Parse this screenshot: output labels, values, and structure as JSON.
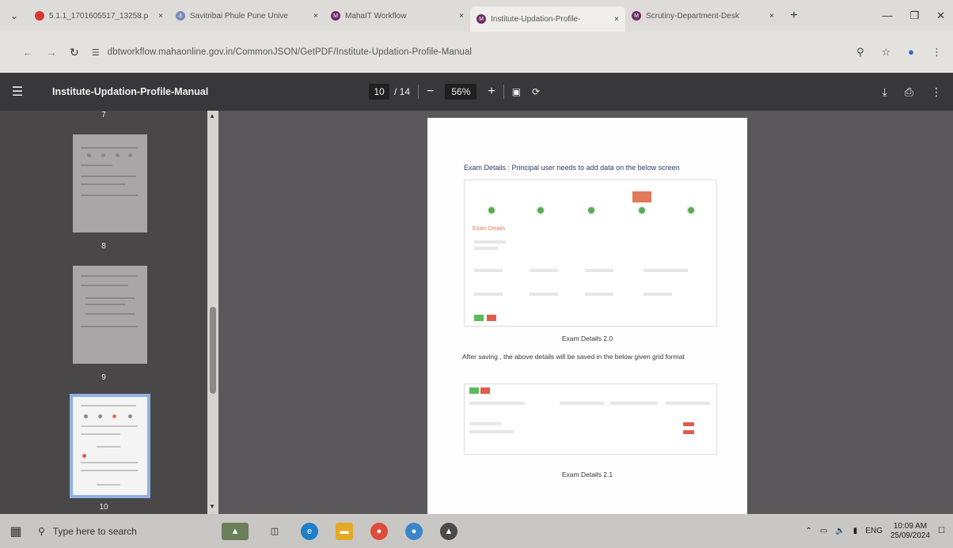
{
  "browser": {
    "tabs": [
      {
        "title": "5.1.1_1701605517_13258.p",
        "fav_color": "#d53a2f",
        "fav_char": ""
      },
      {
        "title": "Savitribai Phule Pune Unive",
        "fav_color": "#7a8ab8",
        "fav_char": "⚓"
      },
      {
        "title": "MahaIT Workflow",
        "fav_color": "#6d2d6a",
        "fav_char": "M"
      },
      {
        "title": "Institute-Updation-Profile-",
        "fav_color": "#6d2d6a",
        "fav_char": "M"
      },
      {
        "title": "Scrutiny-Department-Desk",
        "fav_color": "#6d2d6a",
        "fav_char": "M"
      }
    ],
    "tab_close": "×",
    "new_tab": "+",
    "url": "dbtworkflow.mahaonline.gov.in/CommonJSON/GetPDF/Institute-Updation-Profile-Manual"
  },
  "pdf": {
    "title": "Institute-Updation-Profile-Manual",
    "current_page": "10",
    "total_pages": "/ 14",
    "zoom": "56%",
    "thumbnails": [
      {
        "page": "7"
      },
      {
        "page": "8"
      },
      {
        "page": "9"
      },
      {
        "page": "10"
      }
    ]
  },
  "document": {
    "heading": "Exam Details : Principal user needs to add data on the below screen",
    "exam_details_label": "Exam Details",
    "caption1": "Exam Details 2.0",
    "paragraph": "After saving , the above details will be saved in the below given grid format",
    "caption2": "Exam Details 2.1"
  },
  "taskbar": {
    "search_placeholder": "Type here to search",
    "language": "ENG",
    "time": "10:09 AM",
    "date": "25/09/2024"
  }
}
